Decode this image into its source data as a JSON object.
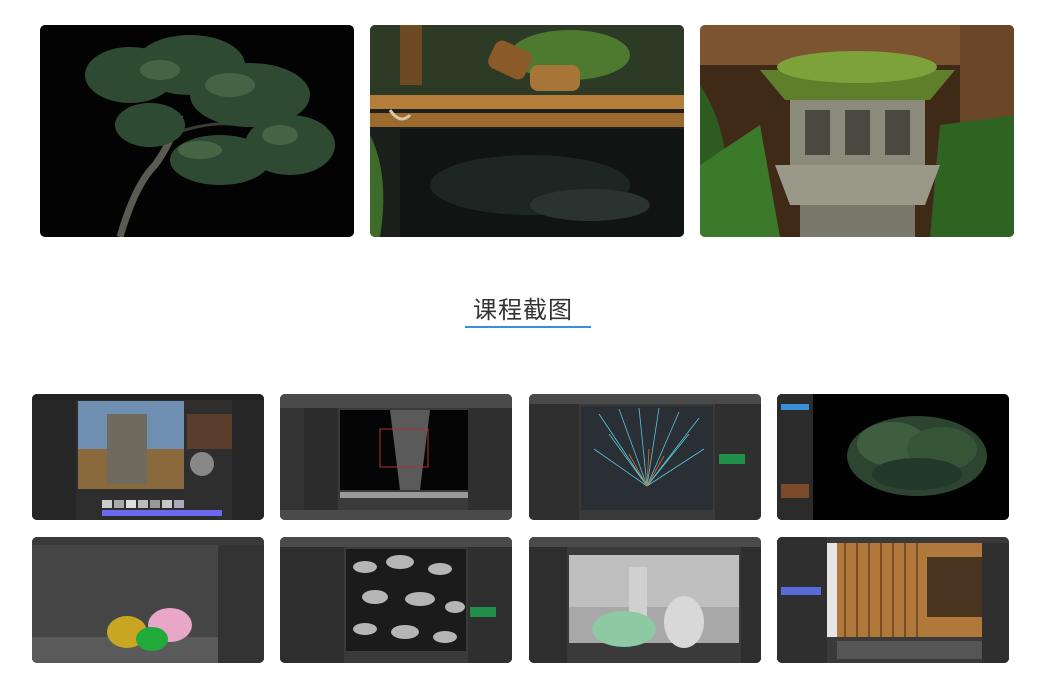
{
  "section": {
    "title": "课程截图"
  },
  "hero_images": [
    {
      "id": "tree-on-black"
    },
    {
      "id": "bamboo-water-fountain"
    },
    {
      "id": "stone-lantern-moss"
    }
  ],
  "screenshots": [
    {
      "id": "lantern-texturing"
    },
    {
      "id": "rock-sculpt-closeup"
    },
    {
      "id": "hair-particles"
    },
    {
      "id": "bush-render"
    },
    {
      "id": "rocks-moss-viewport"
    },
    {
      "id": "leaf-texture-grayscale"
    },
    {
      "id": "lantern-scene-clay"
    },
    {
      "id": "bamboo-fence-texture"
    }
  ],
  "colors": {
    "accent": "#3b8fd9",
    "ui_dark": "#3a3a3a"
  }
}
